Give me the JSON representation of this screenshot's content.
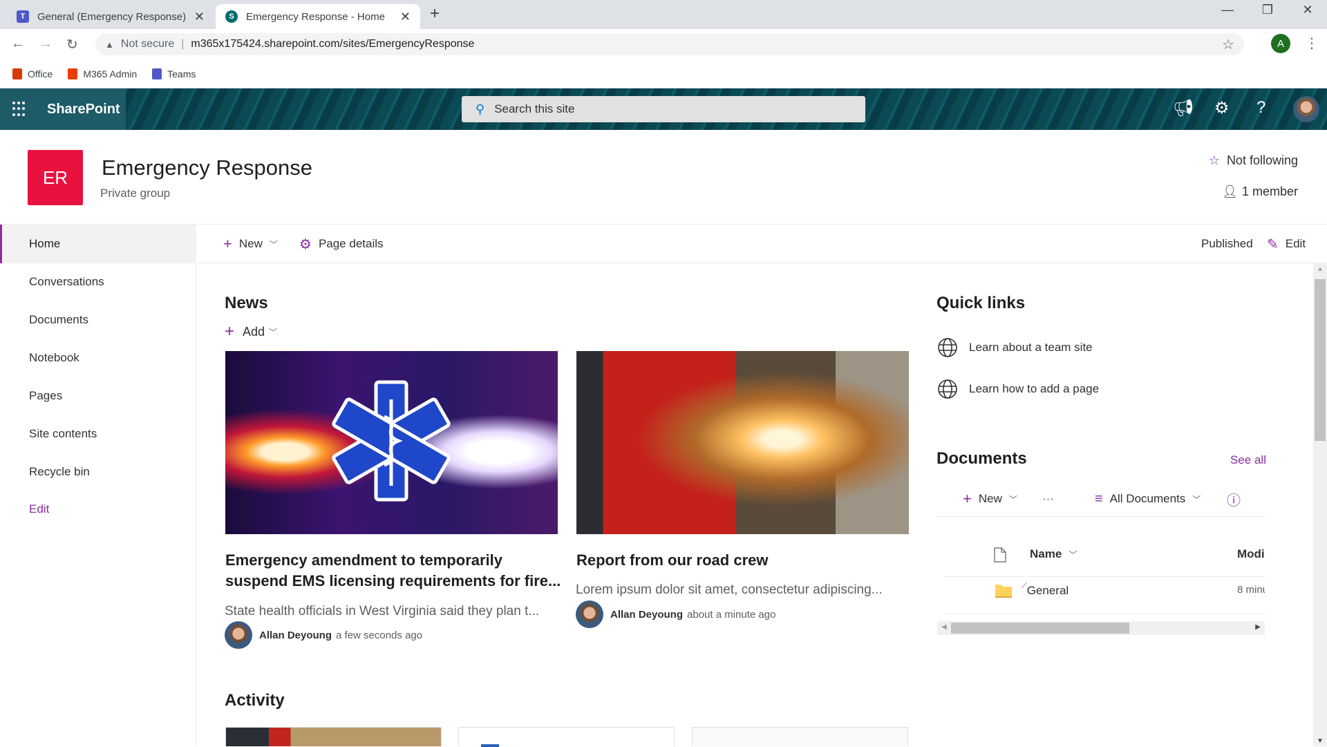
{
  "browser": {
    "tabs": [
      {
        "title": "General (Emergency Response) | Microsoft Teams",
        "icon": "teams-icon",
        "active": false
      },
      {
        "title": "Emergency Response - Home",
        "icon": "sharepoint-icon",
        "active": true
      }
    ],
    "new_tab_glyph": "+",
    "window_controls": {
      "minimize": "—",
      "restore": "❐",
      "close": "✕"
    },
    "security_label": "Not secure",
    "url": "m365x175424.sharepoint.com/sites/EmergencyResponse",
    "profile_initial": "A",
    "bookmarks": [
      {
        "label": "Office",
        "icon": "office-icon",
        "color": "#d83b01"
      },
      {
        "label": "M365 Admin",
        "icon": "office-icon",
        "color": "#eb3c00"
      },
      {
        "label": "Teams",
        "icon": "teams-icon",
        "color": "#5059c9"
      }
    ]
  },
  "suitebar": {
    "app_name": "SharePoint",
    "search_placeholder": "Search this site"
  },
  "site": {
    "logo_initials": "ER",
    "logo_color": "#e81140",
    "title": "Emergency Response",
    "subtitle": "Private group",
    "follow_label": "Not following",
    "members_label": "1 member"
  },
  "nav": {
    "items": [
      {
        "label": "Home",
        "active": true
      },
      {
        "label": "Conversations"
      },
      {
        "label": "Documents"
      },
      {
        "label": "Notebook"
      },
      {
        "label": "Pages"
      },
      {
        "label": "Site contents"
      },
      {
        "label": "Recycle bin"
      },
      {
        "label": "Edit",
        "link": true
      }
    ]
  },
  "commandbar": {
    "new_label": "New",
    "page_details_label": "Page details",
    "status_label": "Published",
    "edit_label": "Edit"
  },
  "news": {
    "title": "News",
    "add_label": "Add",
    "items": [
      {
        "title_line1": "Emergency amendment to temporarily",
        "title_line2": "suspend EMS licensing requirements for fire...",
        "description": "State health officials in West Virginia said they plan t...",
        "author": "Allan Deyoung",
        "time": "a few seconds ago"
      },
      {
        "title_line1": "Report from our road crew",
        "description": "Lorem ipsum dolor sit amet, consectetur adipiscing...",
        "author": "Allan Deyoung",
        "time": "about a minute ago"
      }
    ]
  },
  "quicklinks": {
    "title": "Quick links",
    "items": [
      {
        "label": "Learn about a team site"
      },
      {
        "label": "Learn how to add a page"
      }
    ]
  },
  "documents": {
    "title": "Documents",
    "see_all_label": "See all",
    "new_label": "New",
    "more_label": "···",
    "view_label": "All Documents",
    "columns": {
      "name": "Name",
      "modified": "Modi"
    },
    "rows": [
      {
        "name": "General",
        "type": "folder",
        "modified": "8 minu"
      }
    ]
  },
  "activity": {
    "title": "Activity"
  },
  "colors": {
    "accent": "#8a2da0",
    "suitebar": "#0b4a55"
  }
}
